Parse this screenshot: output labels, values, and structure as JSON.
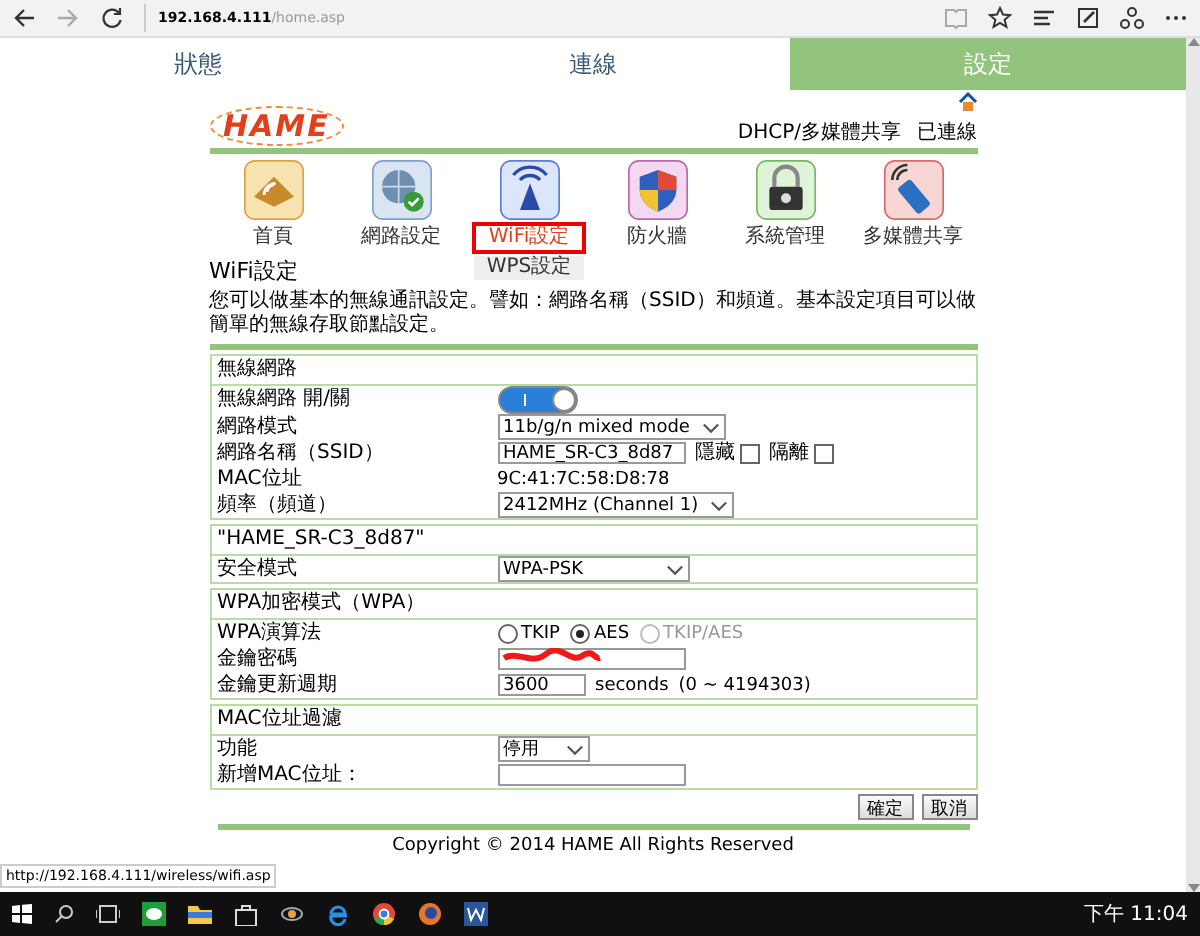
{
  "browser": {
    "address_host": "192.168.4.111",
    "address_path": "/home.asp"
  },
  "tabs": [
    {
      "label": "狀態",
      "selected": false
    },
    {
      "label": "連線",
      "selected": false
    },
    {
      "label": "設定",
      "selected": true
    }
  ],
  "header": {
    "logo": "HAME",
    "status": "DHCP/多媒體共享",
    "connection": "已連線"
  },
  "nav": [
    {
      "kind": "home",
      "label": "首頁"
    },
    {
      "kind": "network",
      "label": "網路設定"
    },
    {
      "kind": "wifi",
      "submenu": [
        {
          "label": "WiFi設定",
          "selected": true
        },
        {
          "label": "WPS設定",
          "selected": false
        }
      ]
    },
    {
      "kind": "firewall",
      "label": "防火牆"
    },
    {
      "kind": "system",
      "label": "系統管理"
    },
    {
      "kind": "media",
      "label": "多媒體共享"
    }
  ],
  "page": {
    "title": "WiFi設定",
    "description": "您可以做基本的無線通訊設定。譬如：網路名稱（SSID）和頻道。基本設定項目可以做簡單的無線存取節點設定。"
  },
  "sections": [
    {
      "title": "無線網路",
      "rows": [
        {
          "label": "無線網路 開/關",
          "kind": "toggle",
          "on": true
        },
        {
          "label": "網路模式",
          "kind": "select",
          "value": "11b/g/n mixed mode"
        },
        {
          "label": "網路名稱（SSID）",
          "kind": "text",
          "value": "HAME_SR-C3_8d87",
          "checks": [
            {
              "label": "隱藏",
              "checked": false
            },
            {
              "label": "隔離",
              "checked": false
            }
          ]
        },
        {
          "label": "MAC位址",
          "kind": "static",
          "value": "9C:41:7C:58:D8:78"
        },
        {
          "label": "頻率（頻道）",
          "kind": "select",
          "value": "2412MHz (Channel 1)"
        }
      ]
    },
    {
      "title": "\"HAME_SR-C3_8d87\"",
      "rows": [
        {
          "label": "安全模式",
          "kind": "select",
          "value": "WPA-PSK"
        }
      ]
    },
    {
      "title": "WPA加密模式（WPA）",
      "rows": [
        {
          "label": "WPA演算法",
          "kind": "radio",
          "options": [
            {
              "label": "TKIP",
              "selected": false,
              "disabled": false
            },
            {
              "label": "AES",
              "selected": true,
              "disabled": false
            },
            {
              "label": "TKIP/AES",
              "selected": false,
              "disabled": true
            }
          ]
        },
        {
          "label": "金鑰密碼",
          "kind": "redacted"
        },
        {
          "label": "金鑰更新週期",
          "kind": "text",
          "value": "3600",
          "suffix": "seconds",
          "hint": "(0 ~ 4194303)"
        }
      ]
    },
    {
      "title": "MAC位址過濾",
      "rows": [
        {
          "label": "功能",
          "kind": "select",
          "value": "停用"
        },
        {
          "label": "新增MAC位址：",
          "kind": "text"
        }
      ]
    }
  ],
  "buttons": [
    "確定",
    "取消"
  ],
  "footer": "Copyright © 2014 HAME All Rights Reserved",
  "status_url": "http://192.168.4.111/wireless/wifi.asp",
  "clock": "下午 11:04"
}
